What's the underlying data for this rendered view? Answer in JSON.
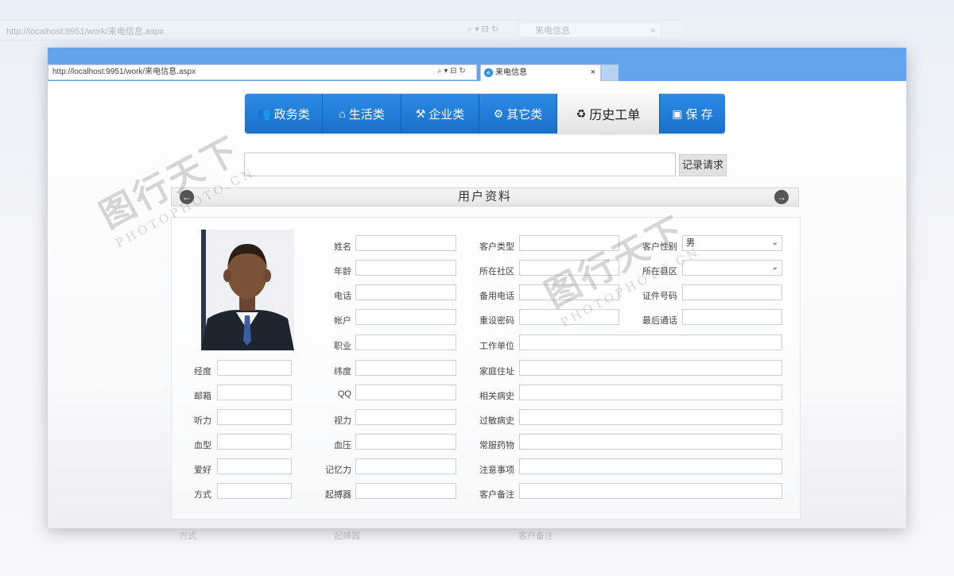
{
  "bg_browser": {
    "url": "http://localhost:9951/work/来电信息.aspx",
    "controls": "⌕ ▾ ⊟ ↻",
    "tab_title": "来电信息",
    "tab_close": "×"
  },
  "browser": {
    "url": "http://localhost:9951/work/来电信息.aspx",
    "controls": "⌕ ▾ ⊟ ↻",
    "tab_title": "来电信息",
    "tab_close": "×",
    "tab_icon": "e"
  },
  "nav": {
    "items": [
      {
        "label": "政务类",
        "icon": "👥"
      },
      {
        "label": "生活类",
        "icon": "⌂"
      },
      {
        "label": "企业类",
        "icon": "⚒"
      },
      {
        "label": "其它类",
        "icon": "⚙"
      },
      {
        "label": "历史工单",
        "icon": "♻"
      },
      {
        "label": "保 存",
        "icon": "▣"
      }
    ]
  },
  "request": {
    "input_value": "",
    "button_label": "记录请求"
  },
  "section": {
    "title": "用户资料",
    "prev": "←",
    "next": "→"
  },
  "form": {
    "left": [
      {
        "label": "经度",
        "value": ""
      },
      {
        "label": "邮箱",
        "value": ""
      },
      {
        "label": "听力",
        "value": ""
      },
      {
        "label": "血型",
        "value": ""
      },
      {
        "label": "爱好",
        "value": ""
      },
      {
        "label": "方式",
        "value": ""
      }
    ],
    "mid": [
      {
        "label": "姓名",
        "value": ""
      },
      {
        "label": "年龄",
        "value": ""
      },
      {
        "label": "电话",
        "value": ""
      },
      {
        "label": "帐户",
        "value": ""
      },
      {
        "label": "职业",
        "value": ""
      },
      {
        "label": "纬度",
        "value": ""
      },
      {
        "label": "QQ",
        "value": ""
      },
      {
        "label": "视力",
        "value": ""
      },
      {
        "label": "血压",
        "value": ""
      },
      {
        "label": "记忆力",
        "value": ""
      },
      {
        "label": "起搏器",
        "value": ""
      }
    ],
    "right": [
      {
        "label": "客户类型",
        "value": ""
      },
      {
        "label": "所在社区",
        "value": ""
      },
      {
        "label": "备用电话",
        "value": ""
      },
      {
        "label": "重设密码",
        "value": ""
      },
      {
        "label": "工作单位",
        "value": ""
      },
      {
        "label": "家庭住址",
        "value": ""
      },
      {
        "label": "相关病史",
        "value": ""
      },
      {
        "label": "过敏病史",
        "value": ""
      },
      {
        "label": "常服药物",
        "value": ""
      },
      {
        "label": "注意事项",
        "value": ""
      },
      {
        "label": "客户备注",
        "value": ""
      }
    ],
    "far": [
      {
        "label": "客户性别",
        "value": "男"
      },
      {
        "label": "所在县区",
        "value": ""
      },
      {
        "label": "证件号码",
        "value": ""
      },
      {
        "label": "最后通话",
        "value": ""
      }
    ]
  },
  "watermark": {
    "brand": "图行天下",
    "sub": "PHOTOPHOTO.CN"
  },
  "bg_bottom": {
    "a": "方式",
    "b": "起搏器",
    "c": "客户备注"
  },
  "colors": {
    "accent": "#1a75cf",
    "titlebar": "#63a4ed"
  }
}
